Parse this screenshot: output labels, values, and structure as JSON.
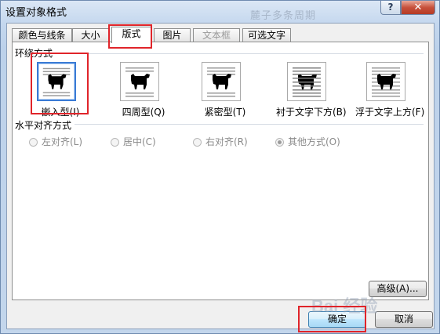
{
  "window": {
    "title": "设置对象格式",
    "ghost_title": "麓子多条周期",
    "help_label": "?",
    "close_label": "✕"
  },
  "tabs": [
    {
      "label": "颜色与线条",
      "state": "normal"
    },
    {
      "label": "大小",
      "state": "normal"
    },
    {
      "label": "版式",
      "state": "active"
    },
    {
      "label": "图片",
      "state": "normal"
    },
    {
      "label": "文本框",
      "state": "disabled"
    },
    {
      "label": "可选文字",
      "state": "normal"
    }
  ],
  "wrap_section": {
    "label": "环绕方式",
    "items": [
      {
        "label": "嵌入型(I)",
        "icon": "inline-wrap-icon",
        "selected": true
      },
      {
        "label": "四周型(Q)",
        "icon": "square-wrap-icon",
        "selected": false
      },
      {
        "label": "紧密型(T)",
        "icon": "tight-wrap-icon",
        "selected": false
      },
      {
        "label": "衬于文字下方(B)",
        "icon": "behind-text-icon",
        "selected": false
      },
      {
        "label": "浮于文字上方(F)",
        "icon": "in-front-of-text-icon",
        "selected": false
      }
    ]
  },
  "align_section": {
    "label": "水平对齐方式",
    "options": [
      {
        "label": "左对齐(L)",
        "checked": false
      },
      {
        "label": "居中(C)",
        "checked": false
      },
      {
        "label": "右对齐(R)",
        "checked": false
      },
      {
        "label": "其他方式(O)",
        "checked": true
      }
    ]
  },
  "buttons": {
    "advanced": "高级(A)...",
    "ok": "确定",
    "cancel": "取消"
  },
  "watermark": "Bai 经验",
  "colors": {
    "highlight": "#e0242a",
    "selected_border": "#3a7bd5"
  }
}
